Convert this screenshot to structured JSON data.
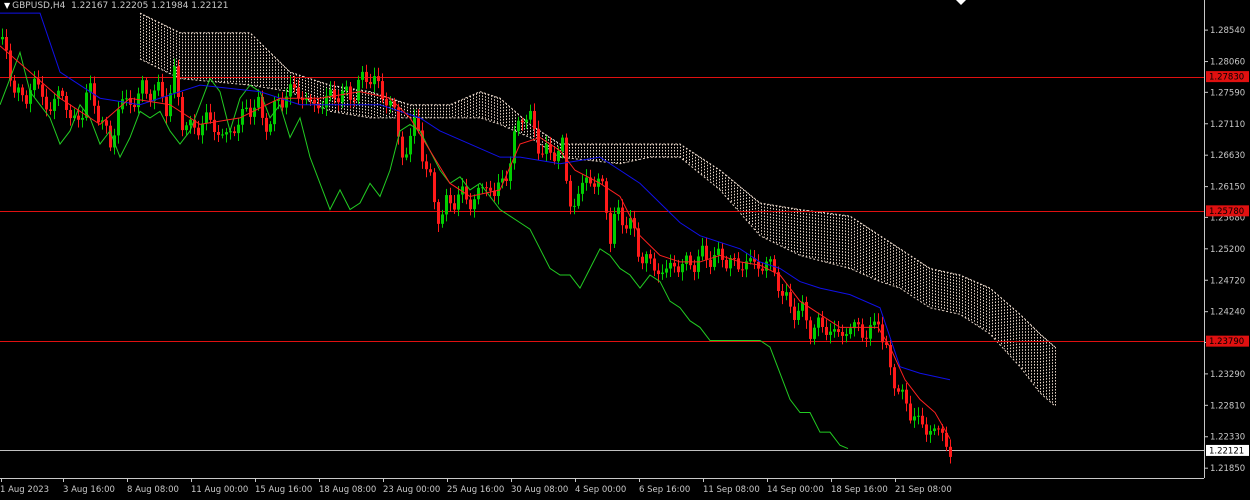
{
  "header": {
    "symbol": "GBPUSD,H4",
    "ohlc": "1.22167 1.22205 1.21984 1.22121"
  },
  "colors": {
    "background": "#000000",
    "bull": "#00cc00",
    "bear": "#ff1a1a",
    "tenkan": "#ff2020",
    "kijun": "#1010e8",
    "chikou": "#22cc22",
    "cloud": "#e8d6c8",
    "hline": "#e01010",
    "price_line": "#c0c0c0",
    "axis_text": "#c8c8c8"
  },
  "chart_data": {
    "type": "candlestick",
    "title": "GBPUSD,H4",
    "ylim": [
      1.217,
      1.29
    ],
    "y_ticks": [
      "1.28540",
      "1.28060",
      "1.27590",
      "1.27110",
      "1.26630",
      "1.26150",
      "1.25680",
      "1.25200",
      "1.24720",
      "1.24240",
      "1.23770",
      "1.23290",
      "1.22810",
      "1.22330",
      "1.21850"
    ],
    "x_ticks": [
      "1 Aug 2023",
      "3 Aug 16:00",
      "8 Aug 08:00",
      "11 Aug 00:00",
      "15 Aug 16:00",
      "18 Aug 08:00",
      "23 Aug 00:00",
      "25 Aug 16:00",
      "30 Aug 08:00",
      "4 Sep 00:00",
      "6 Sep 16:00",
      "11 Sep 08:00",
      "14 Sep 00:00",
      "18 Sep 16:00",
      "21 Sep 08:00"
    ],
    "horizontal_lines": [
      {
        "price": 1.2783,
        "label": "1.27830"
      },
      {
        "price": 1.2578,
        "label": "1.25780"
      },
      {
        "price": 1.2379,
        "label": "1.23790"
      }
    ],
    "current_price": {
      "price": 1.22121,
      "label": "1.22121"
    },
    "price_path": [
      [
        0,
        1.284
      ],
      [
        8,
        1.28
      ],
      [
        16,
        1.276
      ],
      [
        24,
        1.274
      ],
      [
        32,
        1.278
      ],
      [
        40,
        1.276
      ],
      [
        48,
        1.273
      ],
      [
        56,
        1.275
      ],
      [
        64,
        1.276
      ],
      [
        72,
        1.27
      ],
      [
        80,
        1.273
      ],
      [
        88,
        1.276
      ],
      [
        96,
        1.274
      ],
      [
        104,
        1.27
      ],
      [
        110,
        1.268
      ],
      [
        118,
        1.273
      ],
      [
        126,
        1.275
      ],
      [
        134,
        1.274
      ],
      [
        142,
        1.277
      ],
      [
        148,
        1.275
      ],
      [
        152,
        1.2765
      ],
      [
        158,
        1.276
      ],
      [
        166,
        1.274
      ],
      [
        174,
        1.278
      ],
      [
        182,
        1.272
      ],
      [
        190,
        1.27
      ],
      [
        200,
        1.271
      ],
      [
        208,
        1.272
      ],
      [
        216,
        1.27
      ],
      [
        224,
        1.269
      ],
      [
        232,
        1.27
      ],
      [
        240,
        1.272
      ],
      [
        248,
        1.273
      ],
      [
        256,
        1.275
      ],
      [
        262,
        1.271
      ],
      [
        270,
        1.272
      ],
      [
        278,
        1.274
      ],
      [
        286,
        1.276
      ],
      [
        296,
        1.276
      ],
      [
        304,
        1.275
      ],
      [
        312,
        1.274
      ],
      [
        320,
        1.274
      ],
      [
        328,
        1.275
      ],
      [
        336,
        1.276
      ],
      [
        344,
        1.275
      ],
      [
        352,
        1.276
      ],
      [
        360,
        1.277
      ],
      [
        368,
        1.279
      ],
      [
        376,
        1.277
      ],
      [
        384,
        1.275
      ],
      [
        392,
        1.274
      ],
      [
        396,
        1.272
      ],
      [
        400,
        1.266
      ],
      [
        406,
        1.267
      ],
      [
        412,
        1.27
      ],
      [
        416,
        1.272
      ],
      [
        424,
        1.265
      ],
      [
        430,
        1.262
      ],
      [
        436,
        1.258
      ],
      [
        442,
        1.257
      ],
      [
        448,
        1.259
      ],
      [
        456,
        1.26
      ],
      [
        464,
        1.26
      ],
      [
        472,
        1.259
      ],
      [
        480,
        1.261
      ],
      [
        488,
        1.262
      ],
      [
        494,
        1.26
      ],
      [
        500,
        1.262
      ],
      [
        508,
        1.264
      ],
      [
        516,
        1.27
      ],
      [
        522,
        1.273
      ],
      [
        528,
        1.272
      ],
      [
        536,
        1.269
      ],
      [
        542,
        1.267
      ],
      [
        548,
        1.266
      ],
      [
        556,
        1.267
      ],
      [
        562,
        1.268
      ],
      [
        568,
        1.259
      ],
      [
        574,
        1.259
      ],
      [
        580,
        1.261
      ],
      [
        588,
        1.263
      ],
      [
        596,
        1.262
      ],
      [
        604,
        1.261
      ],
      [
        610,
        1.254
      ],
      [
        616,
        1.257
      ],
      [
        622,
        1.257
      ],
      [
        628,
        1.256
      ],
      [
        634,
        1.254
      ],
      [
        640,
        1.251
      ],
      [
        648,
        1.25
      ],
      [
        656,
        1.249
      ],
      [
        664,
        1.248
      ],
      [
        672,
        1.25
      ],
      [
        680,
        1.249
      ],
      [
        688,
        1.25
      ],
      [
        696,
        1.25
      ],
      [
        704,
        1.251
      ],
      [
        710,
        1.251
      ],
      [
        716,
        1.25
      ],
      [
        722,
        1.251
      ],
      [
        730,
        1.25
      ],
      [
        736,
        1.249
      ],
      [
        744,
        1.25
      ],
      [
        752,
        1.25
      ],
      [
        760,
        1.249
      ],
      [
        766,
        1.25
      ],
      [
        772,
        1.249
      ],
      [
        778,
        1.247
      ],
      [
        784,
        1.244
      ],
      [
        790,
        1.243
      ],
      [
        796,
        1.243
      ],
      [
        802,
        1.242
      ],
      [
        810,
        1.24
      ],
      [
        818,
        1.24
      ],
      [
        826,
        1.24
      ],
      [
        834,
        1.239
      ],
      [
        842,
        1.239
      ],
      [
        850,
        1.24
      ],
      [
        858,
        1.24
      ],
      [
        866,
        1.239
      ],
      [
        872,
        1.239
      ],
      [
        878,
        1.242
      ],
      [
        884,
        1.237
      ],
      [
        890,
        1.233
      ],
      [
        896,
        1.232
      ],
      [
        902,
        1.229
      ],
      [
        908,
        1.227
      ],
      [
        914,
        1.227
      ],
      [
        920,
        1.225
      ],
      [
        926,
        1.224
      ],
      [
        932,
        1.225
      ],
      [
        938,
        1.224
      ],
      [
        944,
        1.223
      ],
      [
        950,
        1.2212
      ]
    ],
    "tenkan_path": [
      [
        0,
        1.283
      ],
      [
        30,
        1.279
      ],
      [
        60,
        1.275
      ],
      [
        100,
        1.271
      ],
      [
        130,
        1.275
      ],
      [
        170,
        1.274
      ],
      [
        200,
        1.271
      ],
      [
        240,
        1.272
      ],
      [
        280,
        1.275
      ],
      [
        320,
        1.275
      ],
      [
        360,
        1.276
      ],
      [
        390,
        1.275
      ],
      [
        410,
        1.272
      ],
      [
        430,
        1.267
      ],
      [
        450,
        1.262
      ],
      [
        470,
        1.26
      ],
      [
        500,
        1.261
      ],
      [
        520,
        1.268
      ],
      [
        540,
        1.269
      ],
      [
        560,
        1.267
      ],
      [
        575,
        1.264
      ],
      [
        600,
        1.262
      ],
      [
        620,
        1.26
      ],
      [
        640,
        1.254
      ],
      [
        660,
        1.251
      ],
      [
        680,
        1.25
      ],
      [
        700,
        1.25
      ],
      [
        720,
        1.251
      ],
      [
        740,
        1.25
      ],
      [
        760,
        1.2495
      ],
      [
        780,
        1.248
      ],
      [
        800,
        1.244
      ],
      [
        820,
        1.242
      ],
      [
        840,
        1.24
      ],
      [
        860,
        1.24
      ],
      [
        878,
        1.24
      ],
      [
        890,
        1.237
      ],
      [
        905,
        1.232
      ],
      [
        920,
        1.229
      ],
      [
        935,
        1.227
      ],
      [
        950,
        1.223
      ]
    ],
    "kijun_path": [
      [
        0,
        1.288
      ],
      [
        40,
        1.288
      ],
      [
        60,
        1.279
      ],
      [
        100,
        1.275
      ],
      [
        140,
        1.274
      ],
      [
        200,
        1.277
      ],
      [
        260,
        1.276
      ],
      [
        300,
        1.274
      ],
      [
        340,
        1.274
      ],
      [
        380,
        1.274
      ],
      [
        400,
        1.273
      ],
      [
        420,
        1.272
      ],
      [
        440,
        1.27
      ],
      [
        470,
        1.268
      ],
      [
        500,
        1.266
      ],
      [
        520,
        1.266
      ],
      [
        560,
        1.265
      ],
      [
        600,
        1.266
      ],
      [
        620,
        1.264
      ],
      [
        640,
        1.262
      ],
      [
        660,
        1.259
      ],
      [
        680,
        1.256
      ],
      [
        700,
        1.254
      ],
      [
        740,
        1.252
      ],
      [
        760,
        1.25
      ],
      [
        780,
        1.249
      ],
      [
        800,
        1.247
      ],
      [
        820,
        1.246
      ],
      [
        850,
        1.245
      ],
      [
        880,
        1.243
      ],
      [
        900,
        1.234
      ],
      [
        920,
        1.233
      ],
      [
        950,
        1.232
      ]
    ],
    "chikou_path": [
      [
        0,
        1.274
      ],
      [
        10,
        1.278
      ],
      [
        20,
        1.282
      ],
      [
        30,
        1.276
      ],
      [
        40,
        1.274
      ],
      [
        50,
        1.272
      ],
      [
        60,
        1.268
      ],
      [
        70,
        1.27
      ],
      [
        80,
        1.274
      ],
      [
        90,
        1.272
      ],
      [
        100,
        1.268
      ],
      [
        110,
        1.27
      ],
      [
        120,
        1.266
      ],
      [
        130,
        1.269
      ],
      [
        140,
        1.273
      ],
      [
        150,
        1.272
      ],
      [
        160,
        1.273
      ],
      [
        170,
        1.27
      ],
      [
        180,
        1.268
      ],
      [
        190,
        1.27
      ],
      [
        200,
        1.274
      ],
      [
        210,
        1.278
      ],
      [
        220,
        1.276
      ],
      [
        230,
        1.27
      ],
      [
        240,
        1.275
      ],
      [
        250,
        1.277
      ],
      [
        260,
        1.276
      ],
      [
        270,
        1.272
      ],
      [
        280,
        1.274
      ],
      [
        290,
        1.269
      ],
      [
        300,
        1.272
      ],
      [
        310,
        1.266
      ],
      [
        320,
        1.262
      ],
      [
        330,
        1.258
      ],
      [
        340,
        1.261
      ],
      [
        350,
        1.258
      ],
      [
        360,
        1.259
      ],
      [
        370,
        1.262
      ],
      [
        380,
        1.26
      ],
      [
        390,
        1.264
      ],
      [
        400,
        1.27
      ],
      [
        410,
        1.271
      ],
      [
        420,
        1.27
      ],
      [
        430,
        1.267
      ],
      [
        440,
        1.264
      ],
      [
        450,
        1.262
      ],
      [
        460,
        1.263
      ],
      [
        470,
        1.261
      ],
      [
        480,
        1.262
      ],
      [
        490,
        1.26
      ],
      [
        500,
        1.258
      ],
      [
        510,
        1.257
      ],
      [
        520,
        1.256
      ],
      [
        530,
        1.255
      ],
      [
        540,
        1.252
      ],
      [
        550,
        1.249
      ],
      [
        560,
        1.248
      ],
      [
        570,
        1.248
      ],
      [
        580,
        1.246
      ],
      [
        590,
        1.249
      ],
      [
        600,
        1.252
      ],
      [
        610,
        1.251
      ],
      [
        620,
        1.249
      ],
      [
        630,
        1.248
      ],
      [
        640,
        1.246
      ],
      [
        650,
        1.248
      ],
      [
        660,
        1.247
      ],
      [
        670,
        1.244
      ],
      [
        680,
        1.243
      ],
      [
        690,
        1.241
      ],
      [
        700,
        1.24
      ],
      [
        710,
        1.238
      ],
      [
        720,
        1.238
      ],
      [
        730,
        1.238
      ],
      [
        740,
        1.238
      ],
      [
        750,
        1.238
      ],
      [
        760,
        1.238
      ],
      [
        770,
        1.237
      ],
      [
        780,
        1.233
      ],
      [
        790,
        1.229
      ],
      [
        800,
        1.227
      ],
      [
        810,
        1.227
      ],
      [
        820,
        1.224
      ],
      [
        830,
        1.224
      ],
      [
        840,
        1.222
      ],
      [
        848,
        1.2215
      ]
    ],
    "cloud_top": [
      [
        140,
        1.288
      ],
      [
        180,
        1.285
      ],
      [
        250,
        1.285
      ],
      [
        290,
        1.279
      ],
      [
        330,
        1.277
      ],
      [
        370,
        1.276
      ],
      [
        410,
        1.274
      ],
      [
        450,
        1.274
      ],
      [
        480,
        1.276
      ],
      [
        500,
        1.275
      ],
      [
        530,
        1.271
      ],
      [
        560,
        1.268
      ],
      [
        620,
        1.268
      ],
      [
        650,
        1.268
      ],
      [
        680,
        1.268
      ],
      [
        720,
        1.264
      ],
      [
        760,
        1.259
      ],
      [
        800,
        1.258
      ],
      [
        850,
        1.257
      ],
      [
        880,
        1.254
      ],
      [
        900,
        1.252
      ],
      [
        930,
        1.249
      ],
      [
        960,
        1.248
      ],
      [
        990,
        1.246
      ],
      [
        1020,
        1.242
      ],
      [
        1040,
        1.239
      ],
      [
        1055,
        1.237
      ]
    ],
    "cloud_bottom": [
      [
        140,
        1.281
      ],
      [
        180,
        1.278
      ],
      [
        250,
        1.277
      ],
      [
        290,
        1.276
      ],
      [
        330,
        1.273
      ],
      [
        370,
        1.272
      ],
      [
        410,
        1.272
      ],
      [
        450,
        1.272
      ],
      [
        480,
        1.272
      ],
      [
        500,
        1.271
      ],
      [
        530,
        1.269
      ],
      [
        560,
        1.266
      ],
      [
        620,
        1.265
      ],
      [
        650,
        1.266
      ],
      [
        680,
        1.266
      ],
      [
        720,
        1.261
      ],
      [
        760,
        1.254
      ],
      [
        800,
        1.251
      ],
      [
        850,
        1.249
      ],
      [
        880,
        1.247
      ],
      [
        900,
        1.246
      ],
      [
        930,
        1.243
      ],
      [
        960,
        1.242
      ],
      [
        990,
        1.239
      ],
      [
        1020,
        1.234
      ],
      [
        1040,
        1.23
      ],
      [
        1055,
        1.228
      ]
    ]
  }
}
